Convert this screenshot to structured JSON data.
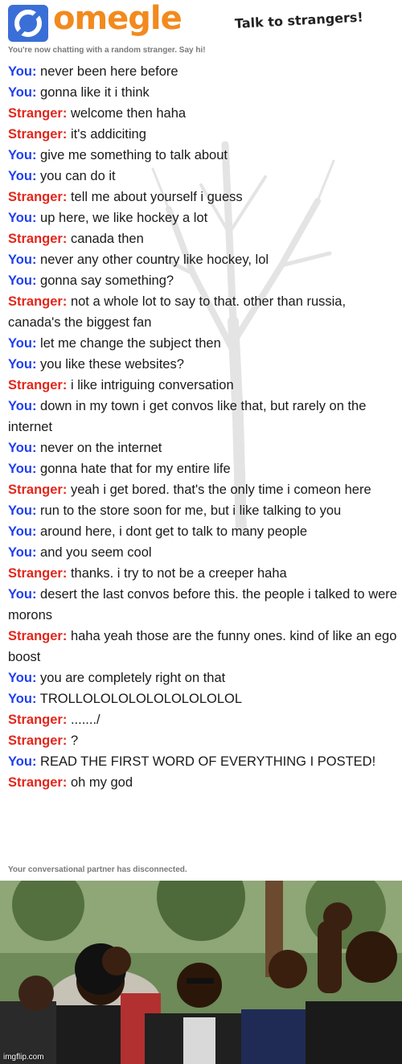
{
  "header": {
    "logo_text": "omegle",
    "tagline": "Talk to strangers!"
  },
  "status_text": "You're now chatting with a random stranger. Say hi!",
  "messages": [
    {
      "speaker": "You:",
      "role": "you",
      "text": "never been here before"
    },
    {
      "speaker": "You:",
      "role": "you",
      "text": "gonna like it i think"
    },
    {
      "speaker": "Stranger:",
      "role": "stranger",
      "text": "welcome then haha"
    },
    {
      "speaker": "Stranger:",
      "role": "stranger",
      "text": "it's addiciting"
    },
    {
      "speaker": "You:",
      "role": "you",
      "text": "give me something to talk about"
    },
    {
      "speaker": "You:",
      "role": "you",
      "text": "you can do it"
    },
    {
      "speaker": "Stranger:",
      "role": "stranger",
      "text": "tell me about yourself i guess"
    },
    {
      "speaker": "You:",
      "role": "you",
      "text": "up here, we like hockey a lot"
    },
    {
      "speaker": "Stranger:",
      "role": "stranger",
      "text": "canada then"
    },
    {
      "speaker": "You:",
      "role": "you",
      "text": "never any other country like hockey, lol"
    },
    {
      "speaker": "You:",
      "role": "you",
      "text": "gonna say something?"
    },
    {
      "speaker": "Stranger:",
      "role": "stranger",
      "text": "not a whole lot to say to that. other than russia, canada's the biggest fan"
    },
    {
      "speaker": "You:",
      "role": "you",
      "text": "let me change the subject then"
    },
    {
      "speaker": "You:",
      "role": "you",
      "text": "you like these websites?"
    },
    {
      "speaker": "Stranger:",
      "role": "stranger",
      "text": "i like intriguing conversation"
    },
    {
      "speaker": "You:",
      "role": "you",
      "text": "down in my town i get convos like that, but rarely on the internet"
    },
    {
      "speaker": "You:",
      "role": "you",
      "text": "never on the internet"
    },
    {
      "speaker": "You:",
      "role": "you",
      "text": "gonna hate that for my entire life"
    },
    {
      "speaker": "Stranger:",
      "role": "stranger",
      "text": "yeah i get bored. that's the only time i comeon here"
    },
    {
      "speaker": "You:",
      "role": "you",
      "text": "run to the store soon for me, but i like talking to you"
    },
    {
      "speaker": "You:",
      "role": "you",
      "text": "around here, i dont get to talk to many people"
    },
    {
      "speaker": "You:",
      "role": "you",
      "text": "and you seem cool"
    },
    {
      "speaker": "Stranger:",
      "role": "stranger",
      "text": "thanks. i try to not be a creeper haha"
    },
    {
      "speaker": "You:",
      "role": "you",
      "text": "desert the last convos before this. the people i talked to were morons"
    },
    {
      "speaker": "Stranger:",
      "role": "stranger",
      "text": "haha yeah those are the funny ones. kind of like an ego boost"
    },
    {
      "speaker": "You:",
      "role": "you",
      "text": "you are completely right on that"
    },
    {
      "speaker": "You:",
      "role": "you",
      "text": "TROLLOLOLOLOLOLOLOLOLOL"
    },
    {
      "speaker": "Stranger:",
      "role": "stranger",
      "text": "......./"
    },
    {
      "speaker": "Stranger:",
      "role": "stranger",
      "text": "?"
    },
    {
      "speaker": "You:",
      "role": "you",
      "text": "READ THE FIRST WORD OF EVERYTHING I POSTED!"
    },
    {
      "speaker": "Stranger:",
      "role": "stranger",
      "text": "oh my god"
    }
  ],
  "disconnect_text": "Your conversational partner has disconnected.",
  "watermark": "imgflip.com",
  "colors": {
    "you": "#1f3ff0",
    "stranger": "#e3261b",
    "logo_orange": "#f28a1e",
    "logo_blue": "#3a6fd8"
  }
}
